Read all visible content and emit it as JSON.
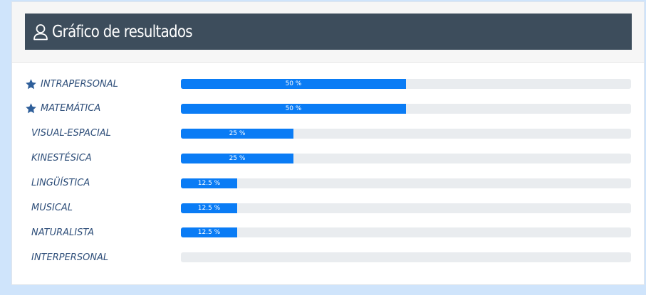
{
  "panel": {
    "title": "Gráfico de resultados",
    "icon": "user-icon"
  },
  "colors": {
    "page_background": "#cfe4fb",
    "title_bar": "#3d4d5c",
    "bar_fill": "#0a7cf5",
    "bar_track": "#e9ecef",
    "label_text": "#2f4f7a"
  },
  "results": [
    {
      "label": "INTRAPERSONAL",
      "value": 50,
      "value_label": "50 %",
      "starred": true
    },
    {
      "label": "MATEMÁTICA",
      "value": 50,
      "value_label": "50 %",
      "starred": true
    },
    {
      "label": "VISUAL-ESPACIAL",
      "value": 25,
      "value_label": "25 %",
      "starred": false
    },
    {
      "label": "KINESTÉSICA",
      "value": 25,
      "value_label": "25 %",
      "starred": false
    },
    {
      "label": "LINGÜÍSTICA",
      "value": 12.5,
      "value_label": "12.5 %",
      "starred": false
    },
    {
      "label": "MUSICAL",
      "value": 12.5,
      "value_label": "12.5 %",
      "starred": false
    },
    {
      "label": "NATURALISTA",
      "value": 12.5,
      "value_label": "12.5 %",
      "starred": false
    },
    {
      "label": "INTERPERSONAL",
      "value": 0,
      "value_label": "",
      "starred": false
    }
  ]
}
